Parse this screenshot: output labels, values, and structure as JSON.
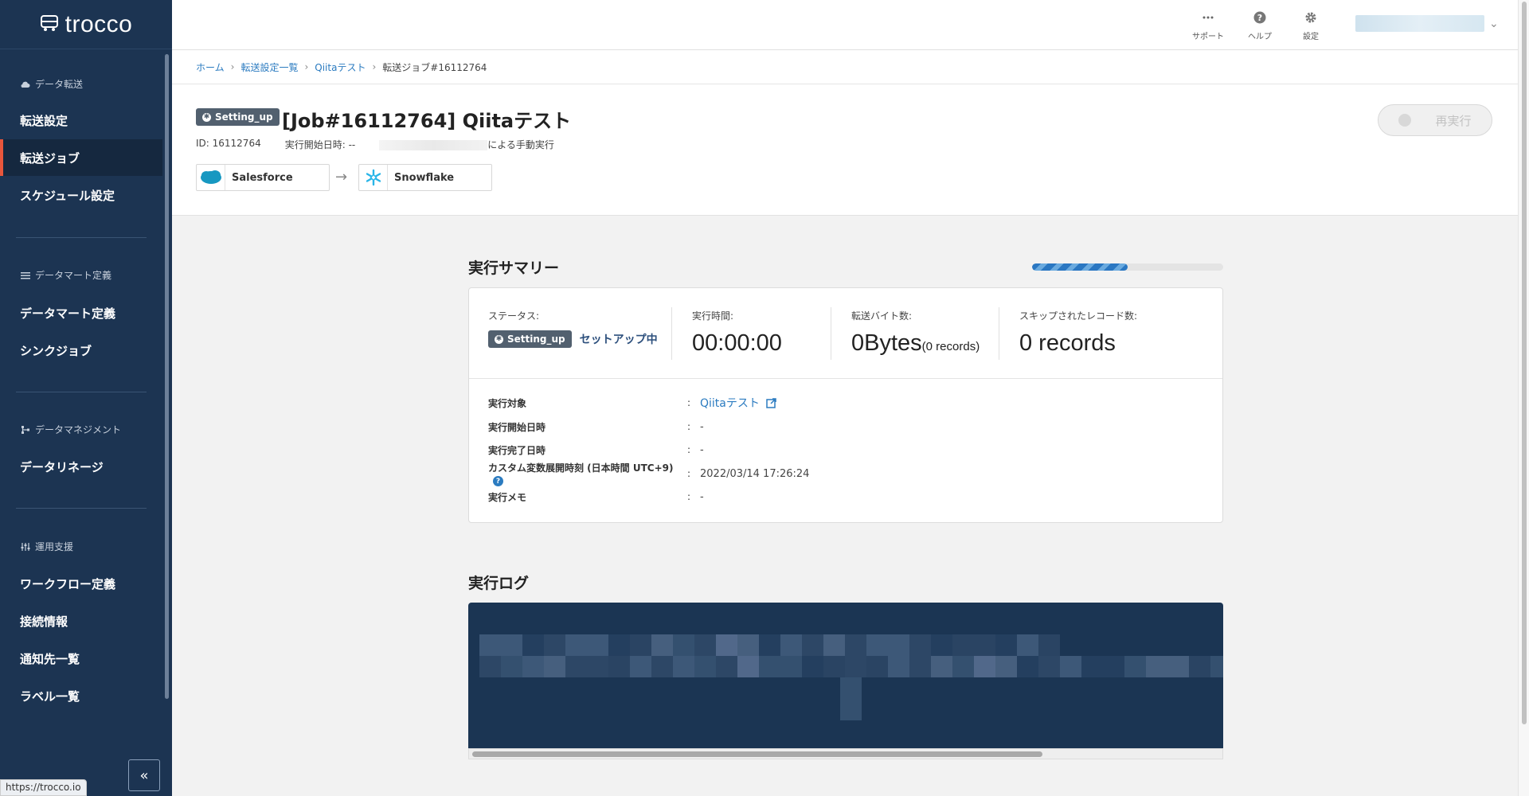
{
  "app": {
    "name": "trocco",
    "status_url": "https://trocco.io"
  },
  "sidebar": {
    "sections": [
      {
        "title": "データ転送",
        "icon": "cloud-icon",
        "items": [
          {
            "label": "転送設定",
            "active": false
          },
          {
            "label": "転送ジョブ",
            "active": true
          },
          {
            "label": "スケジュール設定",
            "active": false
          }
        ]
      },
      {
        "title": "データマート定義",
        "icon": "list-icon",
        "items": [
          {
            "label": "データマート定義",
            "active": false
          },
          {
            "label": "シンクジョブ",
            "active": false
          }
        ]
      },
      {
        "title": "データマネジメント",
        "icon": "lineage-icon",
        "items": [
          {
            "label": "データリネージ",
            "active": false
          }
        ]
      },
      {
        "title": "運用支援",
        "icon": "sliders-icon",
        "items": [
          {
            "label": "ワークフロー定義",
            "active": false
          },
          {
            "label": "接続情報",
            "active": false
          },
          {
            "label": "通知先一覧",
            "active": false
          },
          {
            "label": "ラベル一覧",
            "active": false
          }
        ]
      }
    ],
    "collapse_label": "«"
  },
  "header": {
    "support_label": "サポート",
    "help_label": "ヘルプ",
    "settings_label": "設定"
  },
  "breadcrumb": {
    "home": "ホーム",
    "list": "転送設定一覧",
    "config": "Qiitaテスト",
    "current": "転送ジョブ#16112764",
    "sep": "›"
  },
  "job": {
    "badge": "Setting_up",
    "title": "[Job#16112764] Qiitaテスト",
    "id_text": "ID: 16112764",
    "start_text": "実行開始日時: --",
    "manual_text": "による手動実行",
    "source": "Salesforce",
    "destination": "Snowflake",
    "arrow": "→",
    "rerun_label": "再実行"
  },
  "summary": {
    "title": "実行サマリー",
    "progress": 0.5,
    "status_label": "ステータス:",
    "status_badge": "Setting_up",
    "status_text": "セットアップ中",
    "time_label": "実行時間:",
    "time_value": "00:00:00",
    "bytes_label": "転送バイト数:",
    "bytes_value": "0Bytes",
    "bytes_records": "(0 records)",
    "skipped_label": "スキップされたレコード数:",
    "skipped_value": "0 records",
    "details": {
      "target_label": "実行対象",
      "target_value": "Qiitaテスト",
      "start_label": "実行開始日時",
      "start_value": "-",
      "end_label": "実行完了日時",
      "end_value": "-",
      "custom_label": "カスタム変数展開時刻 (日本時間 UTC+9)",
      "custom_value": "2022/03/14 17:26:24",
      "memo_label": "実行メモ",
      "memo_value": "-",
      "colon": ":",
      "help_mark": "?"
    }
  },
  "log": {
    "title": "実行ログ"
  },
  "colors": {
    "sidebar_bg": "#1c3452",
    "accent": "#e8563c",
    "link": "#2b7bc0",
    "log_bg": "#1b3553"
  }
}
